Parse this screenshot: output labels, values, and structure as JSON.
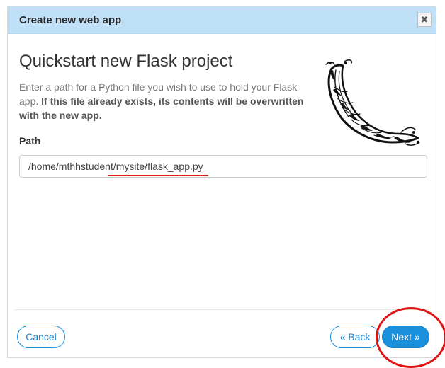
{
  "dialog": {
    "title": "Create new web app",
    "close_label": "✖"
  },
  "main": {
    "heading": "Quickstart new Flask project",
    "description_plain": "Enter a path for a Python file you wish to use to hold your Flask app. ",
    "description_bold": "If this file already exists, its contents will be overwritten with the new app.",
    "path_label": "Path",
    "path_value": "/home/mthhstudent/mysite/flask_app.py"
  },
  "footer": {
    "cancel_label": "Cancel",
    "back_label": "« Back",
    "next_label": "Next »"
  },
  "colors": {
    "header_bg": "#bfe0f7",
    "accent": "#1a8fdc",
    "annotation": "#e01414"
  },
  "icons": {
    "logo": "flask-horn-logo",
    "close": "close-icon"
  }
}
